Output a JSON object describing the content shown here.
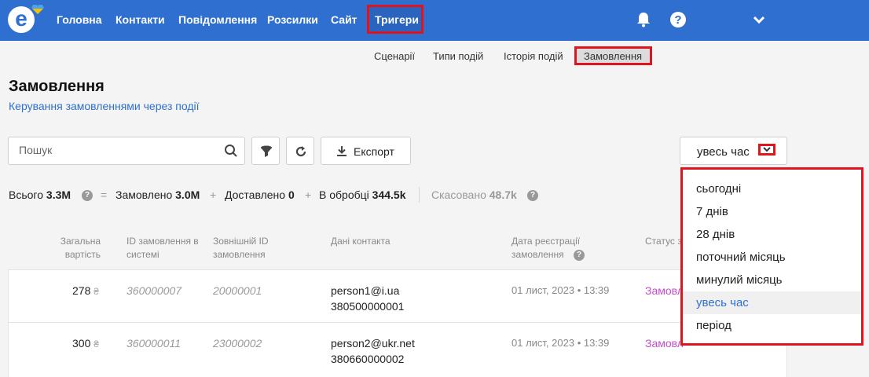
{
  "nav": {
    "items": [
      "Головна",
      "Контакти",
      "Повідомлення",
      "Розсилки",
      "Сайт",
      "Тригери"
    ]
  },
  "subnav": {
    "items": [
      "Сценарії",
      "Типи подій",
      "Історія подій",
      "Замовлення"
    ]
  },
  "page": {
    "title": "Замовлення",
    "subtitle": "Керування замовленнями через події"
  },
  "toolbar": {
    "search_placeholder": "Пошук",
    "export_label": "Експорт",
    "period_label": "увесь час"
  },
  "stats": {
    "total_label": "Всього",
    "total_value": "3.3M",
    "eq": "=",
    "ordered_label": "Замовлено",
    "ordered_value": "3.0M",
    "plus": "+",
    "delivered_label": "Доставлено",
    "delivered_value": "0",
    "processing_label": "В обробці",
    "processing_value": "344.5k",
    "cancelled_label": "Скасовано",
    "cancelled_value": "48.7k"
  },
  "table": {
    "headers": {
      "total": "Загальна вартість",
      "system_id": "ID замовлення в системі",
      "external_id": "Зовнішній ID замовлення",
      "contact": "Дані контакта",
      "date": "Дата реєстрації замовлення",
      "status": "Статус з"
    },
    "currency": "₴",
    "rows": [
      {
        "total": "278",
        "system_id": "360000007",
        "external_id": "20000001",
        "email": "person1@i.ua",
        "phone": "380500000001",
        "date": "01 лист, 2023 • 13:39",
        "status": "Замовл"
      },
      {
        "total": "300",
        "system_id": "360000011",
        "external_id": "23000002",
        "email": "person2@ukr.net",
        "phone": "380660000002",
        "date": "01 лист, 2023 • 13:39",
        "status": "Замовл"
      }
    ]
  },
  "period_dropdown": {
    "options": [
      "сьогодні",
      "7 днів",
      "28 днів",
      "поточний місяць",
      "минулий місяць",
      "увесь час",
      "період"
    ],
    "selected": "увесь час"
  },
  "colors": {
    "brand": "#2f6fd0",
    "highlight": "#e0141e",
    "status": "#c04fc8"
  }
}
